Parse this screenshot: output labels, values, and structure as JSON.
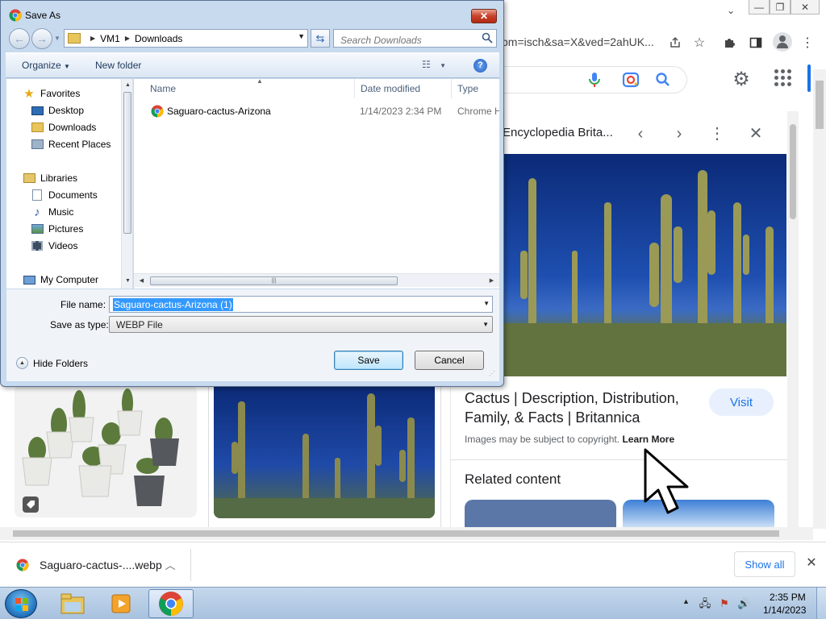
{
  "chrome": {
    "url_fragment": "bm=isch&sa=X&ved=2ahUK...",
    "side_panel": {
      "source": "Encyclopedia Brita...",
      "title": "Cactus | Description, Distribution, Family, & Facts | Britannica",
      "visit_label": "Visit",
      "copyright_text": "Images may be subject to copyright.",
      "learn_more": "Learn More",
      "related_title": "Related content"
    },
    "download_bar": {
      "file_name": "Saguaro-cactus-....webp",
      "show_all_label": "Show all"
    }
  },
  "dialog": {
    "title": "Save As",
    "breadcrumb": [
      "VM1",
      "Downloads"
    ],
    "search_placeholder": "Search Downloads",
    "organize_label": "Organize",
    "new_folder_label": "New folder",
    "nav_items": {
      "favorites": "Favorites",
      "desktop": "Desktop",
      "downloads": "Downloads",
      "recent_places": "Recent Places",
      "libraries": "Libraries",
      "documents": "Documents",
      "music": "Music",
      "pictures": "Pictures",
      "videos": "Videos",
      "my_computer": "My Computer"
    },
    "columns": {
      "name": "Name",
      "date_modified": "Date modified",
      "type": "Type"
    },
    "files": [
      {
        "name": "Saguaro-cactus-Arizona",
        "date": "1/14/2023 2:34 PM",
        "type": "Chrome H"
      }
    ],
    "file_name_label": "File name:",
    "file_name_value": "Saguaro-cactus-Arizona (1)",
    "save_type_label": "Save as type:",
    "save_type_value": "WEBP File",
    "hide_folders_label": "Hide Folders",
    "save_label": "Save",
    "cancel_label": "Cancel"
  },
  "taskbar": {
    "time": "2:35 PM",
    "date": "1/14/2023"
  },
  "colors": {
    "google_blue": "#1a73e8",
    "dialog_frame": "#c8daee",
    "selection": "#3399ff"
  }
}
